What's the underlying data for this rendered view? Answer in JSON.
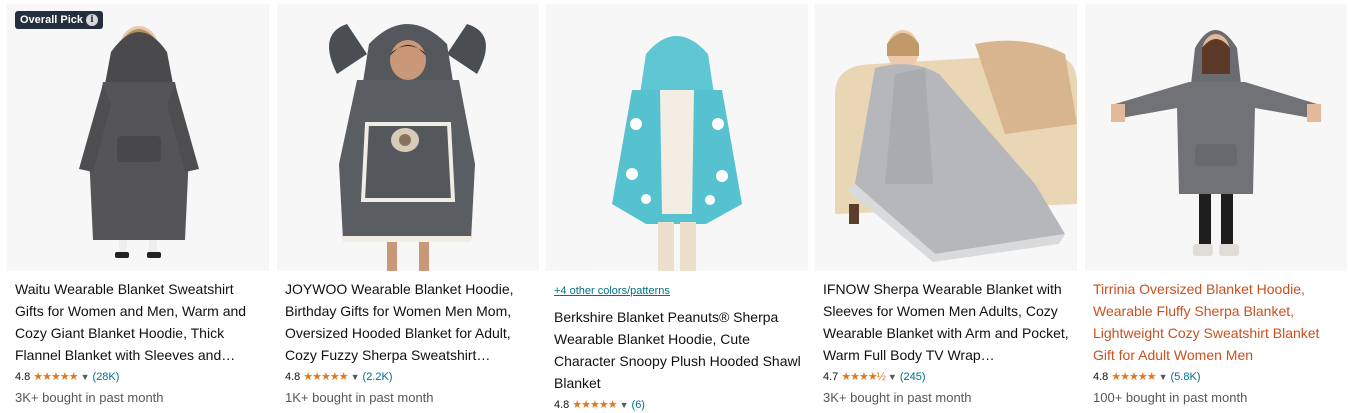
{
  "badge": {
    "label": "Overall Pick",
    "info_icon": "i"
  },
  "products": [
    {
      "title": "Waitu Wearable Blanket Sweatshirt Gifts for Women and Men, Warm and Cozy Giant Blanket Hoodie, Thick Flannel Blanket with Sleeves and…",
      "rating": "4.8",
      "stars": "★★★★★",
      "reviews": "(28K)",
      "bought": "3K+ bought in past month",
      "image_icon": "gray-blanket-hoodie-image"
    },
    {
      "title": "JOYWOO Wearable Blanket Hoodie, Birthday Gifts for Women Men Mom, Oversized Hooded Blanket for Adult, Cozy Fuzzy Sherpa Sweatshirt…",
      "rating": "4.8",
      "stars": "★★★★★",
      "reviews": "(2.2K)",
      "bought": "1K+ bought in past month",
      "image_icon": "hoodie-with-cat-image"
    },
    {
      "colors_link": "+4 other colors/patterns",
      "title": "Berkshire Blanket Peanuts® Sherpa Wearable Blanket Hoodie, Cute Character Snoopy Plush Hooded Shawl Blanket",
      "rating": "4.8",
      "stars": "★★★★★",
      "reviews": "(6)",
      "bought": "",
      "image_icon": "snoopy-hooded-shawl-image"
    },
    {
      "title": "IFNOW Sherpa Wearable Blanket with Sleeves for Women Men Adults, Cozy Wearable Blanket with Arm and Pocket, Warm Full Body TV Wrap…",
      "rating": "4.7",
      "stars": "★★★★½",
      "reviews": "(245)",
      "bought": "3K+ bought in past month",
      "image_icon": "sleeved-blanket-on-couch-image"
    },
    {
      "title": "Tirrinia Oversized Blanket Hoodie, Wearable Fluffy Sherpa Blanket, Lightweight Cozy Sweatshirt Blanket Gift for Adult Women Men",
      "rating": "4.8",
      "stars": "★★★★★",
      "reviews": "(5.8K)",
      "bought": "100+ bought in past month",
      "image_icon": "oversized-hoodie-image"
    }
  ],
  "colors": {
    "star": "#de7921",
    "link": "#007185",
    "title_hover": "#c7511f",
    "badge_bg": "#232f3e"
  }
}
